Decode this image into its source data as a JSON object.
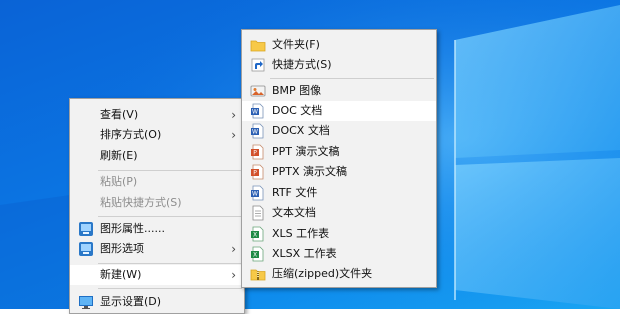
{
  "context_menu": {
    "items": [
      {
        "label": "查看(V)",
        "submenu": true
      },
      {
        "label": "排序方式(O)",
        "submenu": true
      },
      {
        "label": "刷新(E)"
      },
      {
        "label": "粘贴(P)",
        "disabled": true
      },
      {
        "label": "粘贴快捷方式(S)",
        "disabled": true
      },
      {
        "label": "图形属性......",
        "icon": "graphics-properties-icon"
      },
      {
        "label": "图形选项",
        "icon": "graphics-options-icon",
        "submenu": true
      },
      {
        "label": "新建(W)",
        "submenu": true,
        "highlighted": true
      },
      {
        "label": "显示设置(D)",
        "icon": "display-settings-icon"
      }
    ]
  },
  "new_submenu": {
    "items": [
      {
        "label": "文件夹(F)",
        "icon": "folder-icon"
      },
      {
        "label": "快捷方式(S)",
        "icon": "shortcut-icon"
      },
      {
        "label": "BMP 图像",
        "icon": "bmp-image-icon"
      },
      {
        "label": "DOC 文档",
        "icon": "doc-file-icon",
        "highlighted": true
      },
      {
        "label": "DOCX 文档",
        "icon": "docx-file-icon"
      },
      {
        "label": "PPT 演示文稿",
        "icon": "ppt-file-icon"
      },
      {
        "label": "PPTX 演示文稿",
        "icon": "pptx-file-icon"
      },
      {
        "label": "RTF 文件",
        "icon": "rtf-file-icon"
      },
      {
        "label": "文本文档",
        "icon": "text-file-icon"
      },
      {
        "label": "XLS 工作表",
        "icon": "xls-file-icon"
      },
      {
        "label": "XLSX 工作表",
        "icon": "xlsx-file-icon"
      },
      {
        "label": "压缩(zipped)文件夹",
        "icon": "zip-folder-icon"
      }
    ]
  },
  "glyphs": {
    "submenu_arrow": "›"
  },
  "colors": {
    "desktop_blue": "#0b74e2",
    "menu_background": "#f2f2f2",
    "highlight": "#ffffff",
    "disabled_text": "#8d8d8d"
  }
}
